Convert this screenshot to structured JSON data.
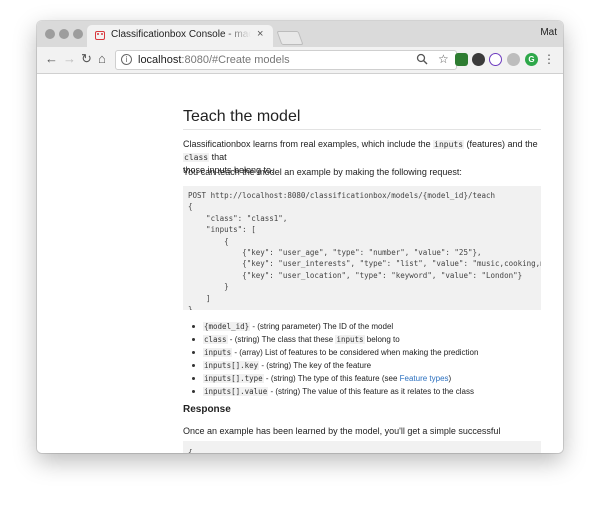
{
  "browser": {
    "tab_title": "Classificationbox Console - machinebox",
    "tab_close": "×",
    "profile": "Mat",
    "url_host": "localhost",
    "url_rest": ":8080/#Create models"
  },
  "doc": {
    "heading": "Teach the model",
    "intro_prefix": "Classificationbox learns from real examples, which include the ",
    "intro_code1": "inputs",
    "intro_mid": " (features) and the ",
    "intro_code2": "class",
    "intro_line1_end": " that",
    "intro_line2": "those inputs belong to.",
    "request_text": "You can teach the model an example by making the following request:",
    "code_request": "POST http://localhost:8080/classificationbox/models/{model_id}/teach\n{\n    \"class\": \"class1\",\n    \"inputs\": [\n        {\n            {\"key\": \"user_age\", \"type\": \"number\", \"value\": \"25\"},\n            {\"key\": \"user_interests\", \"type\": \"list\", \"value\": \"music,cooking,ml\"},\n            {\"key\": \"user_location\", \"type\": \"keyword\", \"value\": \"London\"}\n        }\n    ]\n}",
    "params": [
      {
        "code": "{model_id}",
        "text": " - (string parameter) The ID of the model"
      },
      {
        "code": "class",
        "text": " - (string) The class that these ",
        "code2": "inputs",
        "text2": " belong to"
      },
      {
        "code": "inputs",
        "text": " - (array) List of features to be considered when making the prediction"
      },
      {
        "code": "inputs[].key",
        "text": " - (string) The key of the feature"
      },
      {
        "code": "inputs[].type",
        "text": " - (string) The type of this feature (see ",
        "link": "Feature types",
        "text2": ")"
      },
      {
        "code": "inputs[].value",
        "text": " - (string) The value of this feature as it relates to the class"
      }
    ],
    "response_heading": "Response",
    "response_text": "Once an example has been learned by the model, you'll get a simple successful response:",
    "code_response": "{\n    \"success\": true\n}"
  }
}
